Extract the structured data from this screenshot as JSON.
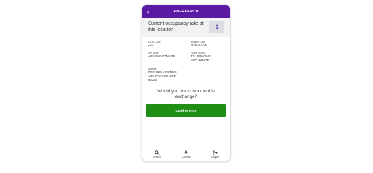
{
  "header": {
    "title": "ABERAERON",
    "back_icon": "chevron-left-icon"
  },
  "occupancy": {
    "label": "Current occupancy rate at this location",
    "value": "1"
  },
  "details": {
    "a1141_code_label": "A1141 Code",
    "a1141_code_value": "AAI",
    "building_code_label": "Building Code",
    "building_code_value": "SA0104A1",
    "site_name_label": "Site Name",
    "site_name_value": "ABERAERON ATE",
    "type_function_label": "Type/Function",
    "type_function_value": "TELEPHONE EXCHANGE",
    "address_label": "Address",
    "address_lines": [
      "PRINCES AVENUE",
      "ABERDEENSHIRE",
      "Wales"
    ]
  },
  "prompt": "Would you like to work at this exchange?",
  "confirm_label": "Confirm entry",
  "nav": {
    "items": [
      {
        "label": "Search",
        "icon": "search-icon"
      },
      {
        "label": "Current",
        "icon": "pin-icon"
      },
      {
        "label": "Logout",
        "icon": "logout-icon"
      }
    ]
  },
  "colors": {
    "header_bg": "#5b1aa3",
    "confirm_bg": "#1e8e15",
    "occupancy_value_text": "#4b2a9c"
  }
}
